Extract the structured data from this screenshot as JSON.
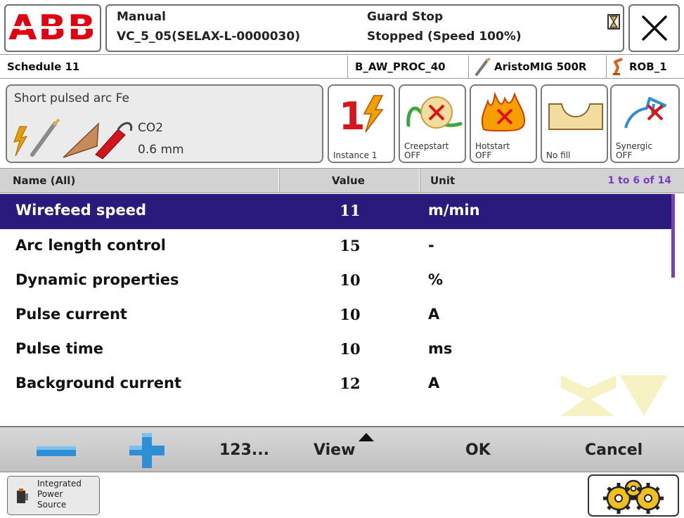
{
  "header": {
    "logo": "ABB",
    "mode": "Manual",
    "system_name": "VC_5_05(SELAX-L-0000030)",
    "state": "Guard Stop",
    "run_state": "Stopped (Speed 100%)",
    "close_icon": "close-icon",
    "status_icon": "hourglass-icon"
  },
  "infobar": {
    "title": "Schedule 11",
    "process": "B_AW_PROC_40",
    "power_source": "AristoMIG 500R",
    "robot": "ROB_1"
  },
  "process_panel": {
    "description": "Short pulsed arc Fe",
    "gas": "CO2",
    "wire_diameter": "0.6 mm"
  },
  "tiles": [
    {
      "label": "Instance 1",
      "icon": "instance-icon"
    },
    {
      "label": "Creepstart\nOFF",
      "icon": "creepstart-icon"
    },
    {
      "label": "Hotstart\nOFF",
      "icon": "hotstart-icon"
    },
    {
      "label": "No fill",
      "icon": "crater-fill-icon"
    },
    {
      "label": "Synergic\nOFF",
      "icon": "synergic-icon"
    }
  ],
  "tile_labels": {
    "instance": "Instance 1",
    "creep_1": "Creepstart",
    "creep_2": "OFF",
    "hot_1": "Hotstart",
    "hot_2": "OFF",
    "fill": "No fill",
    "syn_1": "Synergic",
    "syn_2": "OFF"
  },
  "table": {
    "col_name": "Name (All)",
    "col_value": "Value",
    "col_unit": "Unit",
    "pager": "1 to 6 of 14",
    "rows": [
      {
        "name": "Wirefeed speed",
        "value": "11",
        "unit": "m/min",
        "selected": true
      },
      {
        "name": "Arc length control",
        "value": "15",
        "unit": "-",
        "selected": false
      },
      {
        "name": "Dynamic properties",
        "value": "10",
        "unit": "%",
        "selected": false
      },
      {
        "name": "Pulse current",
        "value": "10",
        "unit": "A",
        "selected": false
      },
      {
        "name": "Pulse time",
        "value": "10",
        "unit": "ms",
        "selected": false
      },
      {
        "name": "Background current",
        "value": "12",
        "unit": "A",
        "selected": false
      }
    ]
  },
  "commands": {
    "minus_icon": "minus-icon",
    "plus_icon": "plus-icon",
    "numpad": "123...",
    "view": "View",
    "ok": "OK",
    "cancel": "Cancel"
  },
  "footer": {
    "task_label_1": "Integrated",
    "task_label_2": "Power",
    "task_label_3": "Source",
    "quickset_icon": "gears-icon"
  },
  "colors": {
    "brand_red": "#e4000f",
    "selection": "#2a1a7c",
    "accent_purple": "#7b3dbf",
    "plus_minus_blue": "#2f8fd6"
  }
}
